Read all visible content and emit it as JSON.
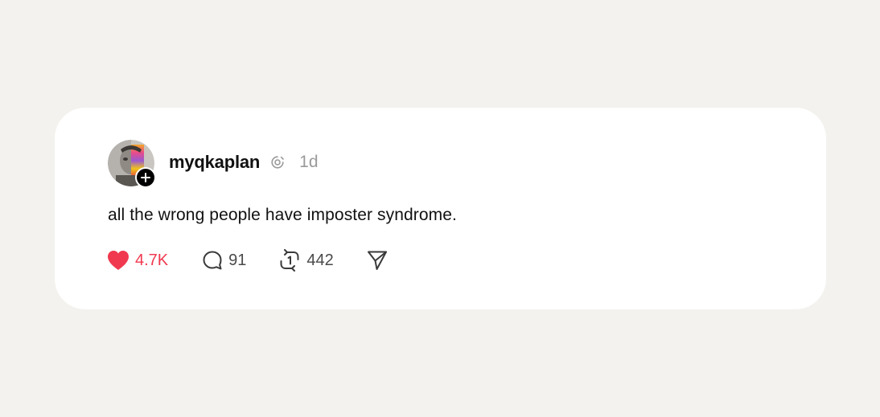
{
  "post": {
    "username": "myqkaplan",
    "time": "1d",
    "text": "all the wrong people have imposter syndrome.",
    "likes": "4.7K",
    "replies": "91",
    "reposts": "442",
    "liked": true
  },
  "colors": {
    "page_background": "#f3f2ee",
    "card_background": "#ffffff",
    "like_red": "#f0394f",
    "text_primary": "#111111",
    "text_secondary": "#9a9a9a",
    "count_gray": "#4a4a4a"
  },
  "icons": {
    "verified": "threads-verified-icon",
    "follow": "plus-icon",
    "like": "heart-icon",
    "reply": "comment-bubble-icon",
    "repost": "repost-arrows-icon",
    "share": "send-paper-plane-icon"
  }
}
